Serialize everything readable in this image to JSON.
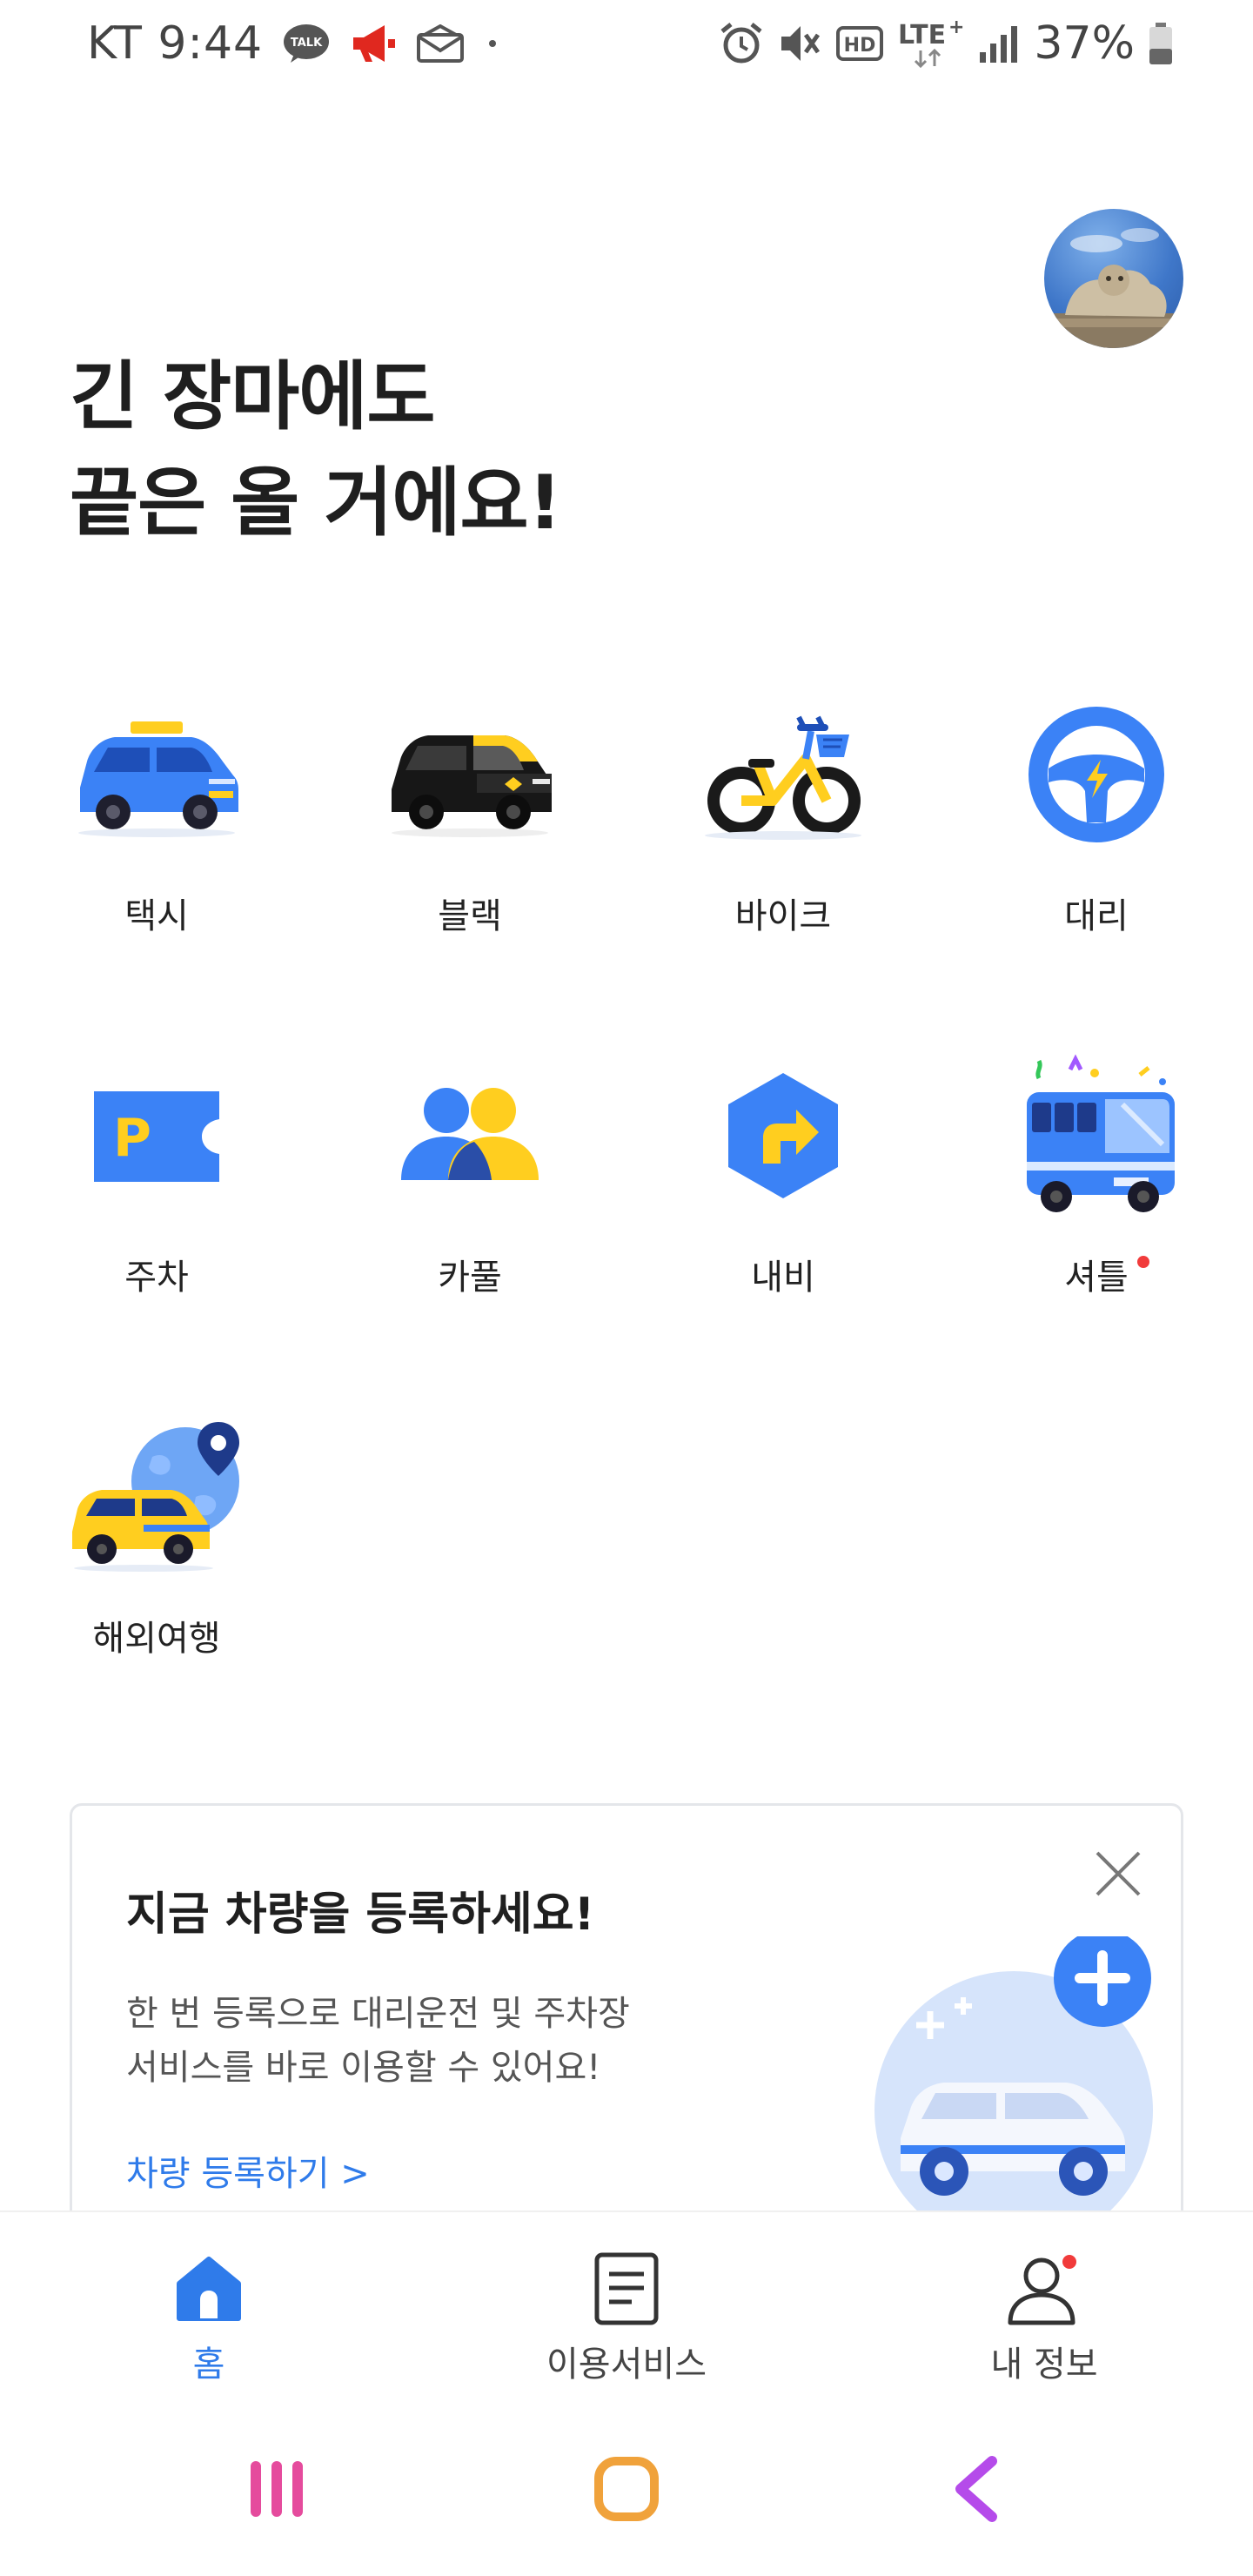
{
  "status_bar": {
    "carrier_time": "KT 9:44",
    "network": "LTE+",
    "battery": "37%"
  },
  "headline": {
    "line1": "긴 장마에도",
    "line2": "끝은 올 거에요!"
  },
  "services": [
    {
      "label": "택시",
      "icon": "taxi-icon"
    },
    {
      "label": "블랙",
      "icon": "black-car-icon"
    },
    {
      "label": "바이크",
      "icon": "bike-icon"
    },
    {
      "label": "대리",
      "icon": "steering-wheel-icon"
    },
    {
      "label": "주차",
      "icon": "parking-ticket-icon"
    },
    {
      "label": "카풀",
      "icon": "carpool-people-icon"
    },
    {
      "label": "내비",
      "icon": "navigation-icon"
    },
    {
      "label": "셔틀",
      "icon": "shuttle-bus-icon",
      "badge": true
    },
    {
      "label": "해외여행",
      "icon": "overseas-travel-icon"
    }
  ],
  "promo_card": {
    "title": "지금 차량을 등록하세요!",
    "desc_line1": "한 번 등록으로 대리운전 및 주차장",
    "desc_line2": "서비스를 바로 이용할 수 있어요!",
    "link": "차량 등록하기 >"
  },
  "bottom_nav": {
    "items": [
      {
        "label": "홈",
        "active": true
      },
      {
        "label": "이용서비스",
        "active": false
      },
      {
        "label": "내 정보",
        "active": false,
        "badge": true
      }
    ]
  },
  "colors": {
    "accent_blue": "#2f7bea",
    "icon_blue": "#3b82f6",
    "icon_yellow": "#ffce1f",
    "badge_red": "#f13b3b"
  }
}
